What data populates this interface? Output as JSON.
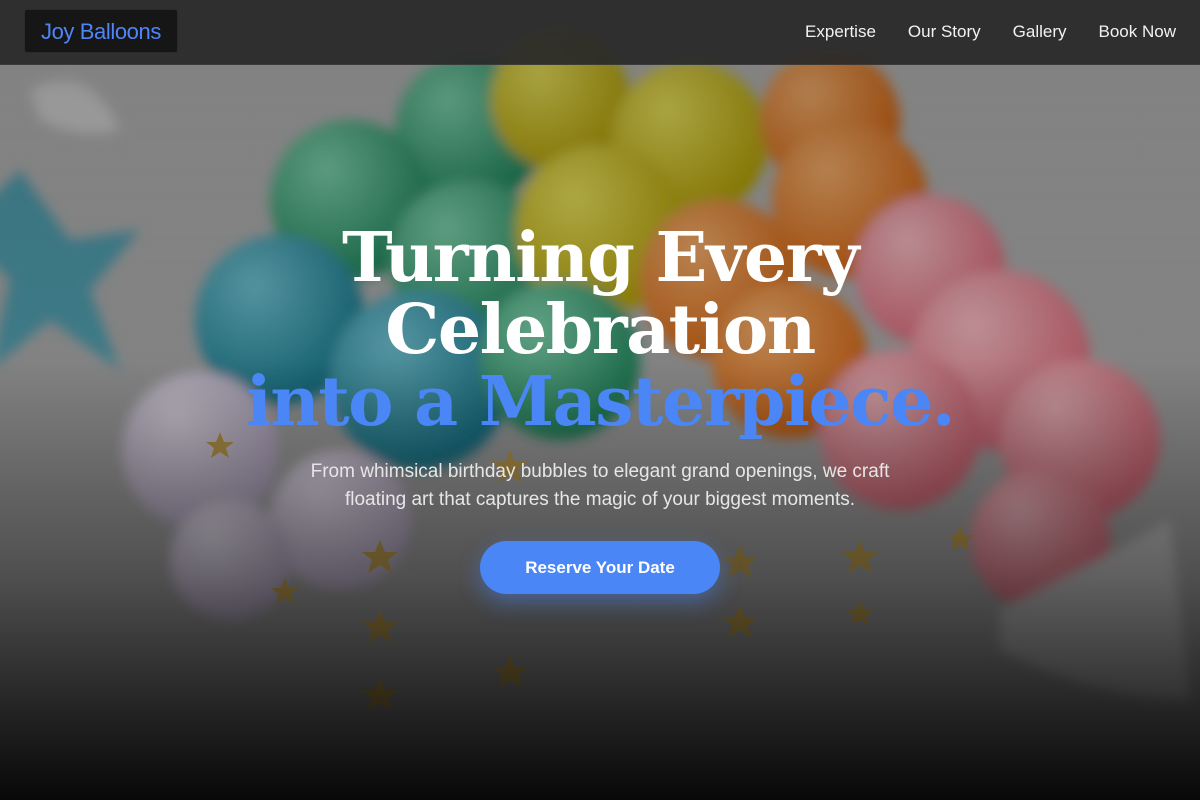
{
  "header": {
    "logo": "Joy Balloons",
    "nav": [
      {
        "label": "Expertise"
      },
      {
        "label": "Our Story"
      },
      {
        "label": "Gallery"
      },
      {
        "label": "Book Now"
      }
    ]
  },
  "hero": {
    "title_line1": "Turning Every",
    "title_line2": "Celebration",
    "title_accent": "into a Masterpiece.",
    "subtitle_line1": "From whimsical birthday bubbles to elegant grand openings, we craft",
    "subtitle_line2": "floating art that captures the magic of your biggest moments.",
    "cta_label": "Reserve Your Date",
    "background_image": "balloon-garland-photo"
  },
  "colors": {
    "accent": "#4a86f6",
    "nav_background": "#2a2a2a",
    "logo_background": "#161616"
  }
}
